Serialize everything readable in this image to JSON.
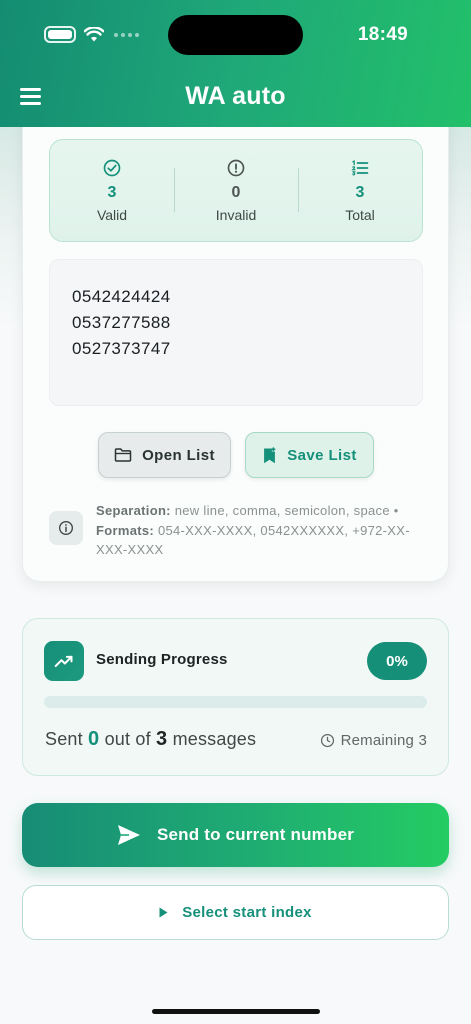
{
  "status_bar": {
    "time": "18:49"
  },
  "header": {
    "title": "WA auto"
  },
  "stats": {
    "valid": {
      "value": "3",
      "label": "Valid"
    },
    "invalid": {
      "value": "0",
      "label": "Invalid"
    },
    "total": {
      "value": "3",
      "label": "Total"
    }
  },
  "numbers_input": {
    "lines": [
      "0542424424",
      "0537277588",
      "0527373747"
    ]
  },
  "list_buttons": {
    "open_label": "Open List",
    "save_label": "Save List"
  },
  "info": {
    "separation_label": "Separation:",
    "separation_text": "new line, comma, semicolon, space •",
    "formats_label": "Formats:",
    "formats_text": "054-XXX-XXXX, 0542XXXXXX, +972-XX-XXX-XXXX"
  },
  "progress": {
    "title": "Sending Progress",
    "percent_label": "0%",
    "fraction": 0,
    "sent_prefix": "Sent",
    "sent_count": "0",
    "sent_middle": "out of",
    "total_count": "3",
    "sent_suffix": "messages",
    "remaining_label": "Remaining 3"
  },
  "actions": {
    "send_label": "Send to current number",
    "start_index_label": "Select start index"
  },
  "colors": {
    "accent": "#168f78",
    "accent_light": "#24cc63"
  }
}
